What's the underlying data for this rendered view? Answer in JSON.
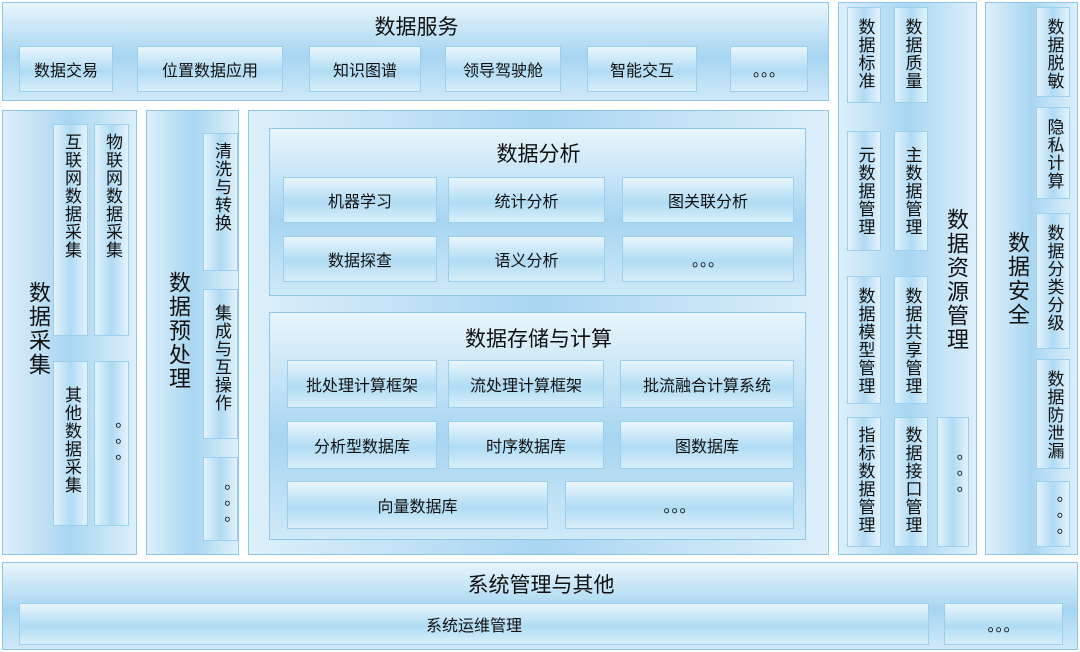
{
  "data_service": {
    "title": "数据服务",
    "items": [
      "数据交易",
      "位置数据应用",
      "知识图谱",
      "领导驾驶舱",
      "智能交互",
      "。。。"
    ]
  },
  "data_collection": {
    "title": "数据采集",
    "items": [
      "互联网数据采集",
      "物联网数据采集",
      "其他数据采集",
      "。。。"
    ]
  },
  "preprocessing": {
    "title": "数据预处理",
    "items": [
      "清洗与转换",
      "集成与互操作",
      "。。。"
    ]
  },
  "analysis": {
    "title": "数据分析",
    "items": [
      "机器学习",
      "统计分析",
      "图关联分析",
      "数据探查",
      "语义分析",
      "。。。"
    ]
  },
  "storage": {
    "title": "数据存储与计算",
    "items": [
      "批处理计算框架",
      "流处理计算框架",
      "批流融合计算系统",
      "分析型数据库",
      "时序数据库",
      "图数据库",
      "向量数据库",
      "。。。"
    ]
  },
  "resource_mgmt": {
    "title": "数据资源管理",
    "items": [
      "数据标准",
      "数据质量",
      "元数据管理",
      "主数据管理",
      "数据模型管理",
      "数据共享管理",
      "指标数据管理",
      "数据接口管理",
      "。。。"
    ]
  },
  "security": {
    "title": "数据安全",
    "items": [
      "数据脱敏",
      "隐私计算",
      "数据分类分级",
      "数据防泄漏",
      "。。。"
    ]
  },
  "system_mgmt": {
    "title": "系统管理与其他",
    "items": [
      "系统运维管理",
      "。。。"
    ]
  }
}
